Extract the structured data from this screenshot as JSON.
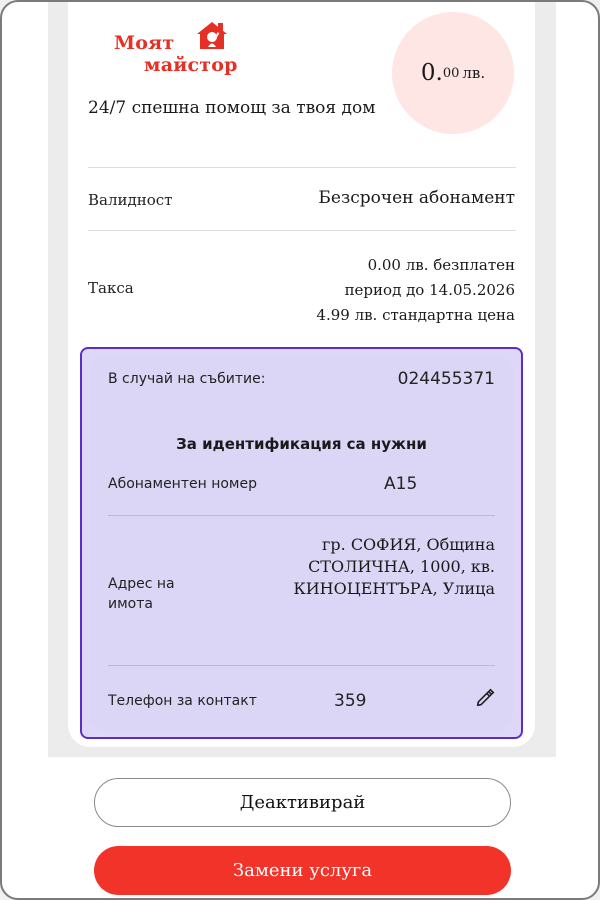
{
  "brand": {
    "logo_line1": "Моят",
    "logo_line2": "майстор",
    "tagline": "24/7 спешна помощ за твоя дом",
    "accent_color": "#e53026"
  },
  "price": {
    "amount": "0.",
    "cents": "00",
    "currency": "лв."
  },
  "validity": {
    "label": "Валидност",
    "value": "Безсрочен абонамент"
  },
  "fee": {
    "label": "Такса",
    "line1": "0.00 лв. безплатен",
    "line2": "период до 14.05.2026",
    "line3": "4.99 лв. стандартна цена"
  },
  "event_box": {
    "event_label": "В случай на събитие:",
    "event_phone": "024455371",
    "heading": "За идентификация са нужни",
    "subscription_label": "Абонаментен номер",
    "subscription_value": "A15",
    "address_label_line1": "Адрес на",
    "address_label_line2": "имота",
    "address_line1": "гр. СОФИЯ, Община",
    "address_line2": "СТОЛИЧНА, 1000, кв.",
    "address_line3": "КИНОЦЕНТЪРА, Улица",
    "phone_label": "Телефон за контакт",
    "phone_value": "359",
    "edit_icon": "pencil-icon",
    "border_color": "#5a2fc7"
  },
  "actions": {
    "deactivate_label": "Деактивирай",
    "replace_label": "Замени услуга",
    "replace_color": "#f2332a"
  }
}
